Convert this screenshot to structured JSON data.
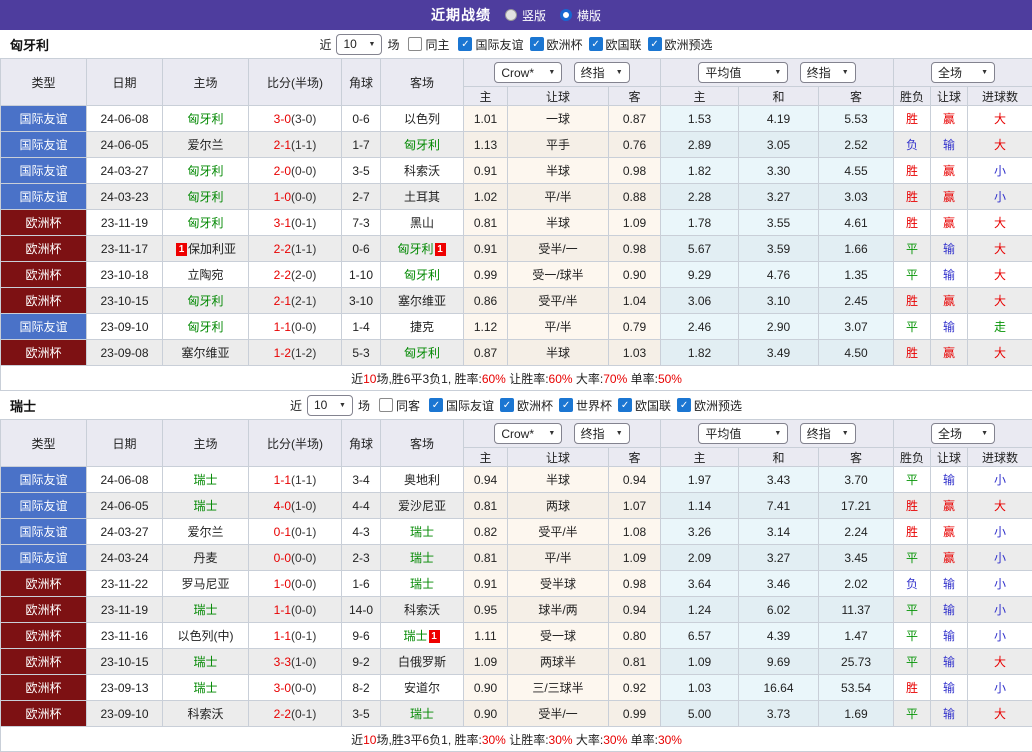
{
  "header": {
    "title": "近期战绩",
    "vertical_label": "竖版",
    "horizontal_label": "横版"
  },
  "filter_labels": {
    "near": "近",
    "games": "场"
  },
  "table_controls": {
    "odds_source": "Crow*",
    "final_label": "终指",
    "average_label": "平均值",
    "full_label": "全场"
  },
  "table_columns": {
    "main": [
      "类型",
      "日期",
      "主场",
      "比分(半场)",
      "角球",
      "客场"
    ],
    "sub": [
      "主",
      "让球",
      "客",
      "主",
      "和",
      "客",
      "胜负",
      "让球",
      "进球数"
    ]
  },
  "colors": {
    "accent_purple": "#4e3d9e",
    "league": {
      "国际友谊": "#4a72c8",
      "欧洲杯": "#7d1113"
    },
    "team_green": "#008800",
    "score_red": "#e80000",
    "result_text": {
      "胜": "#e80000",
      "负": "#3333cc",
      "平": "#089508",
      "赢": "#e80000",
      "输": "#3333cc",
      "大": "#e80000",
      "小": "#3333cc",
      "走": "#089508"
    }
  },
  "sections": [
    {
      "team": "匈牙利",
      "filter": {
        "count": "10",
        "same_label": "同主",
        "same_checked": false,
        "leagues": [
          "国际友谊",
          "欧洲杯",
          "欧国联",
          "欧洲预选"
        ]
      },
      "rows": [
        {
          "league": "国际友谊",
          "date": "24-06-08",
          "home": {
            "name": "匈牙利",
            "green": true
          },
          "score": "3-0",
          "half": "(3-0)",
          "corner": "0-6",
          "away": {
            "name": "以色列"
          },
          "o1": [
            "1.01",
            "一球",
            "0.87"
          ],
          "o2": [
            "1.53",
            "4.19",
            "5.53"
          ],
          "res": [
            "胜",
            "赢",
            "大"
          ]
        },
        {
          "league": "国际友谊",
          "date": "24-06-05",
          "home": {
            "name": "爱尔兰"
          },
          "score": "2-1",
          "half": "(1-1)",
          "corner": "1-7",
          "away": {
            "name": "匈牙利",
            "green": true
          },
          "o1": [
            "1.13",
            "平手",
            "0.76"
          ],
          "o2": [
            "2.89",
            "3.05",
            "2.52"
          ],
          "res": [
            "负",
            "输",
            "大"
          ]
        },
        {
          "league": "国际友谊",
          "date": "24-03-27",
          "home": {
            "name": "匈牙利",
            "green": true
          },
          "score": "2-0",
          "half": "(0-0)",
          "corner": "3-5",
          "away": {
            "name": "科索沃"
          },
          "o1": [
            "0.91",
            "半球",
            "0.98"
          ],
          "o2": [
            "1.82",
            "3.30",
            "4.55"
          ],
          "res": [
            "胜",
            "赢",
            "小"
          ]
        },
        {
          "league": "国际友谊",
          "date": "24-03-23",
          "home": {
            "name": "匈牙利",
            "green": true
          },
          "score": "1-0",
          "half": "(0-0)",
          "corner": "2-7",
          "away": {
            "name": "土耳其"
          },
          "o1": [
            "1.02",
            "平/半",
            "0.88"
          ],
          "o2": [
            "2.28",
            "3.27",
            "3.03"
          ],
          "res": [
            "胜",
            "赢",
            "小"
          ]
        },
        {
          "league": "欧洲杯",
          "date": "23-11-19",
          "home": {
            "name": "匈牙利",
            "green": true
          },
          "score": "3-1",
          "half": "(0-1)",
          "corner": "7-3",
          "away": {
            "name": "黑山"
          },
          "o1": [
            "0.81",
            "半球",
            "1.09"
          ],
          "o2": [
            "1.78",
            "3.55",
            "4.61"
          ],
          "res": [
            "胜",
            "赢",
            "大"
          ]
        },
        {
          "league": "欧洲杯",
          "date": "23-11-17",
          "home": {
            "name": "保加利亚",
            "card": "1",
            "card_side": "left"
          },
          "score": "2-2",
          "half": "(1-1)",
          "corner": "0-6",
          "away": {
            "name": "匈牙利",
            "green": true,
            "card": "1",
            "card_side": "right"
          },
          "o1": [
            "0.91",
            "受半/一",
            "0.98"
          ],
          "o2": [
            "5.67",
            "3.59",
            "1.66"
          ],
          "res": [
            "平",
            "输",
            "大"
          ]
        },
        {
          "league": "欧洲杯",
          "date": "23-10-18",
          "home": {
            "name": "立陶宛"
          },
          "score": "2-2",
          "half": "(2-0)",
          "corner": "1-10",
          "away": {
            "name": "匈牙利",
            "green": true
          },
          "o1": [
            "0.99",
            "受一/球半",
            "0.90"
          ],
          "o2": [
            "9.29",
            "4.76",
            "1.35"
          ],
          "res": [
            "平",
            "输",
            "大"
          ]
        },
        {
          "league": "欧洲杯",
          "date": "23-10-15",
          "home": {
            "name": "匈牙利",
            "green": true
          },
          "score": "2-1",
          "half": "(2-1)",
          "corner": "3-10",
          "away": {
            "name": "塞尔维亚"
          },
          "o1": [
            "0.86",
            "受平/半",
            "1.04"
          ],
          "o2": [
            "3.06",
            "3.10",
            "2.45"
          ],
          "res": [
            "胜",
            "赢",
            "大"
          ]
        },
        {
          "league": "国际友谊",
          "date": "23-09-10",
          "home": {
            "name": "匈牙利",
            "green": true
          },
          "score": "1-1",
          "half": "(0-0)",
          "corner": "1-4",
          "away": {
            "name": "捷克"
          },
          "o1": [
            "1.12",
            "平/半",
            "0.79"
          ],
          "o2": [
            "2.46",
            "2.90",
            "3.07"
          ],
          "res": [
            "平",
            "输",
            "走"
          ]
        },
        {
          "league": "欧洲杯",
          "date": "23-09-08",
          "home": {
            "name": "塞尔维亚"
          },
          "score": "1-2",
          "half": "(1-2)",
          "corner": "5-3",
          "away": {
            "name": "匈牙利",
            "green": true
          },
          "o1": [
            "0.87",
            "半球",
            "1.03"
          ],
          "o2": [
            "1.82",
            "3.49",
            "4.50"
          ],
          "res": [
            "胜",
            "赢",
            "大"
          ]
        }
      ],
      "summary": [
        {
          "t": "近"
        },
        {
          "t": "10",
          "red": true
        },
        {
          "t": "场,胜6平3负1, 胜率:"
        },
        {
          "t": "60%",
          "red": true
        },
        {
          "t": " 让胜率:"
        },
        {
          "t": "60%",
          "red": true
        },
        {
          "t": " 大率:"
        },
        {
          "t": "70%",
          "red": true
        },
        {
          "t": " 单率:"
        },
        {
          "t": "50%",
          "red": true
        }
      ]
    },
    {
      "team": "瑞士",
      "filter": {
        "count": "10",
        "same_label": "同客",
        "same_checked": false,
        "leagues": [
          "国际友谊",
          "欧洲杯",
          "世界杯",
          "欧国联",
          "欧洲预选"
        ]
      },
      "rows": [
        {
          "league": "国际友谊",
          "date": "24-06-08",
          "home": {
            "name": "瑞士",
            "green": true
          },
          "score": "1-1",
          "half": "(1-1)",
          "corner": "3-4",
          "away": {
            "name": "奥地利"
          },
          "o1": [
            "0.94",
            "半球",
            "0.94"
          ],
          "o2": [
            "1.97",
            "3.43",
            "3.70"
          ],
          "res": [
            "平",
            "输",
            "小"
          ]
        },
        {
          "league": "国际友谊",
          "date": "24-06-05",
          "home": {
            "name": "瑞士",
            "green": true
          },
          "score": "4-0",
          "half": "(1-0)",
          "corner": "4-4",
          "away": {
            "name": "爱沙尼亚"
          },
          "o1": [
            "0.81",
            "两球",
            "1.07"
          ],
          "o2": [
            "1.14",
            "7.41",
            "17.21"
          ],
          "res": [
            "胜",
            "赢",
            "大"
          ]
        },
        {
          "league": "国际友谊",
          "date": "24-03-27",
          "home": {
            "name": "爱尔兰"
          },
          "score": "0-1",
          "half": "(0-1)",
          "corner": "4-3",
          "away": {
            "name": "瑞士",
            "green": true
          },
          "o1": [
            "0.82",
            "受平/半",
            "1.08"
          ],
          "o2": [
            "3.26",
            "3.14",
            "2.24"
          ],
          "res": [
            "胜",
            "赢",
            "小"
          ]
        },
        {
          "league": "国际友谊",
          "date": "24-03-24",
          "home": {
            "name": "丹麦"
          },
          "score": "0-0",
          "half": "(0-0)",
          "corner": "2-3",
          "away": {
            "name": "瑞士",
            "green": true
          },
          "o1": [
            "0.81",
            "平/半",
            "1.09"
          ],
          "o2": [
            "2.09",
            "3.27",
            "3.45"
          ],
          "res": [
            "平",
            "赢",
            "小"
          ]
        },
        {
          "league": "欧洲杯",
          "date": "23-11-22",
          "home": {
            "name": "罗马尼亚"
          },
          "score": "1-0",
          "half": "(0-0)",
          "corner": "1-6",
          "away": {
            "name": "瑞士",
            "green": true
          },
          "o1": [
            "0.91",
            "受半球",
            "0.98"
          ],
          "o2": [
            "3.64",
            "3.46",
            "2.02"
          ],
          "res": [
            "负",
            "输",
            "小"
          ]
        },
        {
          "league": "欧洲杯",
          "date": "23-11-19",
          "home": {
            "name": "瑞士",
            "green": true
          },
          "score": "1-1",
          "half": "(0-0)",
          "corner": "14-0",
          "away": {
            "name": "科索沃"
          },
          "o1": [
            "0.95",
            "球半/两",
            "0.94"
          ],
          "o2": [
            "1.24",
            "6.02",
            "11.37"
          ],
          "res": [
            "平",
            "输",
            "小"
          ]
        },
        {
          "league": "欧洲杯",
          "date": "23-11-16",
          "home": {
            "name": "以色列(中)"
          },
          "score": "1-1",
          "half": "(0-1)",
          "corner": "9-6",
          "away": {
            "name": "瑞士",
            "green": true,
            "card": "1",
            "card_side": "right"
          },
          "o1": [
            "1.11",
            "受一球",
            "0.80"
          ],
          "o2": [
            "6.57",
            "4.39",
            "1.47"
          ],
          "res": [
            "平",
            "输",
            "小"
          ]
        },
        {
          "league": "欧洲杯",
          "date": "23-10-15",
          "home": {
            "name": "瑞士",
            "green": true
          },
          "score": "3-3",
          "half": "(1-0)",
          "corner": "9-2",
          "away": {
            "name": "白俄罗斯"
          },
          "o1": [
            "1.09",
            "两球半",
            "0.81"
          ],
          "o2": [
            "1.09",
            "9.69",
            "25.73"
          ],
          "res": [
            "平",
            "输",
            "大"
          ]
        },
        {
          "league": "欧洲杯",
          "date": "23-09-13",
          "home": {
            "name": "瑞士",
            "green": true
          },
          "score": "3-0",
          "half": "(0-0)",
          "corner": "8-2",
          "away": {
            "name": "安道尔"
          },
          "o1": [
            "0.90",
            "三/三球半",
            "0.92"
          ],
          "o2": [
            "1.03",
            "16.64",
            "53.54"
          ],
          "res": [
            "胜",
            "输",
            "小"
          ]
        },
        {
          "league": "欧洲杯",
          "date": "23-09-10",
          "home": {
            "name": "科索沃"
          },
          "score": "2-2",
          "half": "(0-1)",
          "corner": "3-5",
          "away": {
            "name": "瑞士",
            "green": true
          },
          "o1": [
            "0.90",
            "受半/一",
            "0.99"
          ],
          "o2": [
            "5.00",
            "3.73",
            "1.69"
          ],
          "res": [
            "平",
            "输",
            "大"
          ]
        }
      ],
      "summary": [
        {
          "t": "近"
        },
        {
          "t": "10",
          "red": true
        },
        {
          "t": "场,胜3平6负1, 胜率:"
        },
        {
          "t": "30%",
          "red": true
        },
        {
          "t": " 让胜率:"
        },
        {
          "t": "30%",
          "red": true
        },
        {
          "t": " 大率:"
        },
        {
          "t": "30%",
          "red": true
        },
        {
          "t": " 单率:"
        },
        {
          "t": "30%",
          "red": true
        }
      ]
    }
  ]
}
